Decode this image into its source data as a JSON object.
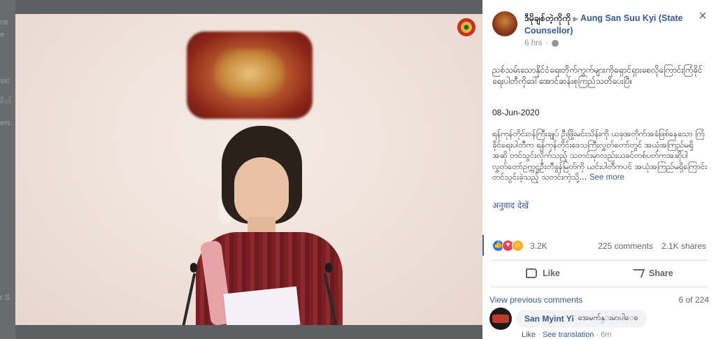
{
  "background_fragments": [
    "ne",
    "e",
    "",
    "sic",
    "စိတ်",
    "ers",
    "",
    "",
    "",
    "",
    "r S"
  ],
  "post": {
    "page_name": "ဒီမိုချစ်တဲ့ကိုကို",
    "target_name": "Aung San Suu Kyi (State Counsellor)",
    "time": "6 hrs",
    "intro": "ညစ်သမ်းသောနိုင်ငံရေးတိုက်ကွက်များကိုရှောင်ရှားစေလိုကြောင်းကြံခိုင်ရေးပါတီကိုဒေါ်အောင်ဆန်းစုကြည်သတိပေးပြီ။",
    "date": "08-Jun-2020",
    "body": "ရန်ကုန်တိုင်းဝန်ကြီးချုပ် ဦးဖြိုးမင်းသိန်းကို ယခုအတိုက်အခံဖြစ်နေသော ကြံခိုင်ရေးပါတီက ရန်ကုန်တိုင်းဒေသကြီးလွှတ်တော်တွင် အယုံအကြည်မရှိအဆို တင်သွင်းလိုက်သည့် သတင်းမှာလည်းယခင်တစ်ပတ်ကအဆိုပါလွှတ်တော်ဥက္ကဋ္ဌဦးတီခွန်မြတ်ကို ယင်းပါတီကပင် အယုံအကြည်မရှိကြောင်း တင်သွင်းခဲ့သည့် သတင်းကဲ့သို့...",
    "see_more": "See more",
    "translate": "अनुवाद देखें"
  },
  "reactions": {
    "count": "3.2K",
    "comments": "225 comments",
    "shares": "2.1K shares"
  },
  "actions": {
    "like": "Like",
    "share": "Share"
  },
  "comments_section": {
    "view_previous": "View previous comments",
    "count": "6 of 224"
  },
  "comment": {
    "author": "San Myint Yi",
    "text": "အေမက်န္းမာပါေစ",
    "like": "Like",
    "see_translation": "See translation",
    "time": "6m"
  },
  "colors": {
    "link": "#385898",
    "like_reaction": "#2078f4",
    "love_reaction": "#f33e58",
    "care_reaction": "#f7b125"
  }
}
